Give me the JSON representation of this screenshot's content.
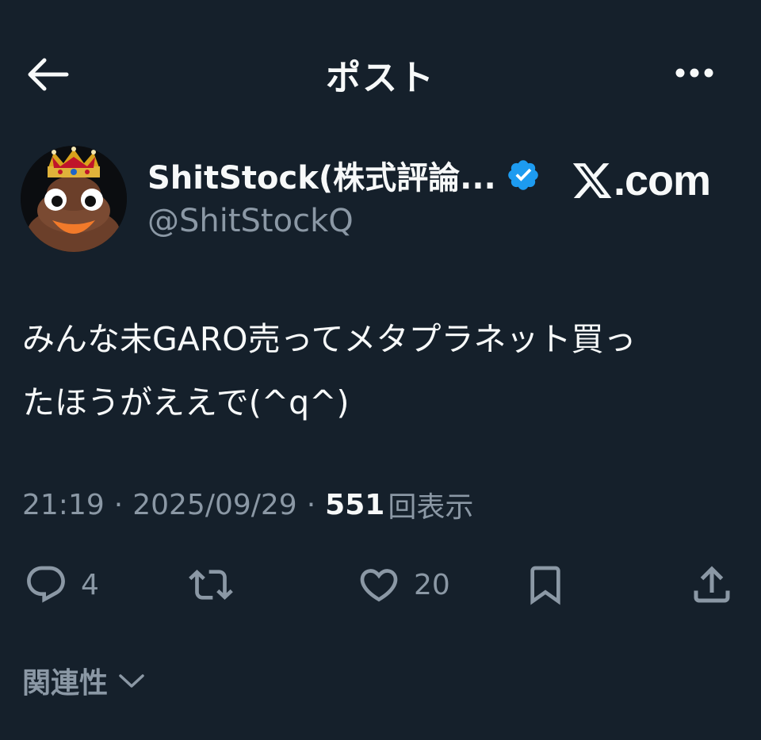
{
  "header": {
    "title": "ポスト"
  },
  "author": {
    "display_name": "ShitStock(株式評論...",
    "handle": "@ShitStockQ",
    "verified": true
  },
  "watermark": {
    "text": ".com"
  },
  "post": {
    "text": "みんな未GARO売ってメタプラネット買っ\nたほうがええで(^q^)"
  },
  "meta": {
    "time": "21:19",
    "separator": "·",
    "date": "2025/09/29",
    "views": "551",
    "views_label": "回表示"
  },
  "actions": {
    "reply_count": "4",
    "retweet_count": "",
    "like_count": "20"
  },
  "related": {
    "label": "関連性"
  },
  "colors": {
    "background": "#15202b",
    "text_primary": "#f7f9f9",
    "text_secondary": "#8b98a5",
    "verified_blue": "#1d9bf0"
  },
  "icons": {
    "back": "arrow-left-icon",
    "more": "more-horizontal-icon",
    "verified": "verified-badge-icon",
    "x_logo": "x-logo-icon",
    "reply": "reply-icon",
    "retweet": "retweet-icon",
    "like": "heart-icon",
    "bookmark": "bookmark-icon",
    "share": "share-icon",
    "chevron": "chevron-down-icon"
  }
}
